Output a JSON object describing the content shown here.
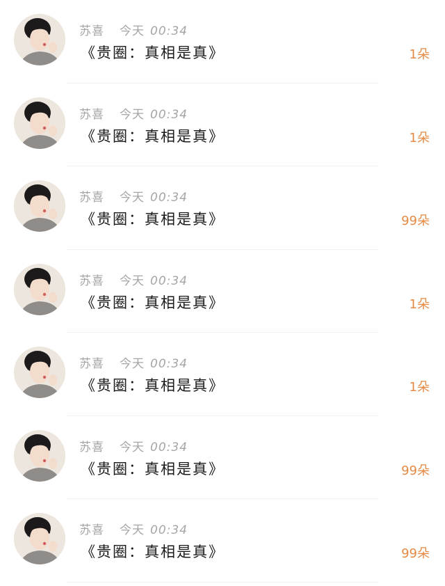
{
  "messages": [
    {
      "author": "苏喜",
      "day": "今天",
      "time": "00:34",
      "title": "《贵圈：真相是真》",
      "gift": "1朵"
    },
    {
      "author": "苏喜",
      "day": "今天",
      "time": "00:34",
      "title": "《贵圈：真相是真》",
      "gift": "1朵"
    },
    {
      "author": "苏喜",
      "day": "今天",
      "time": "00:34",
      "title": "《贵圈：真相是真》",
      "gift": "99朵"
    },
    {
      "author": "苏喜",
      "day": "今天",
      "time": "00:34",
      "title": "《贵圈：真相是真》",
      "gift": "1朵"
    },
    {
      "author": "苏喜",
      "day": "今天",
      "time": "00:34",
      "title": "《贵圈：真相是真》",
      "gift": "1朵"
    },
    {
      "author": "苏喜",
      "day": "今天",
      "time": "00:34",
      "title": "《贵圈：真相是真》",
      "gift": "99朵"
    },
    {
      "author": "苏喜",
      "day": "今天",
      "time": "00:34",
      "title": "《贵圈：真相是真》",
      "gift": "99朵"
    }
  ],
  "colors": {
    "gift": "#e58a45",
    "meta": "#a5a5a5",
    "title": "#1a1a1a"
  }
}
